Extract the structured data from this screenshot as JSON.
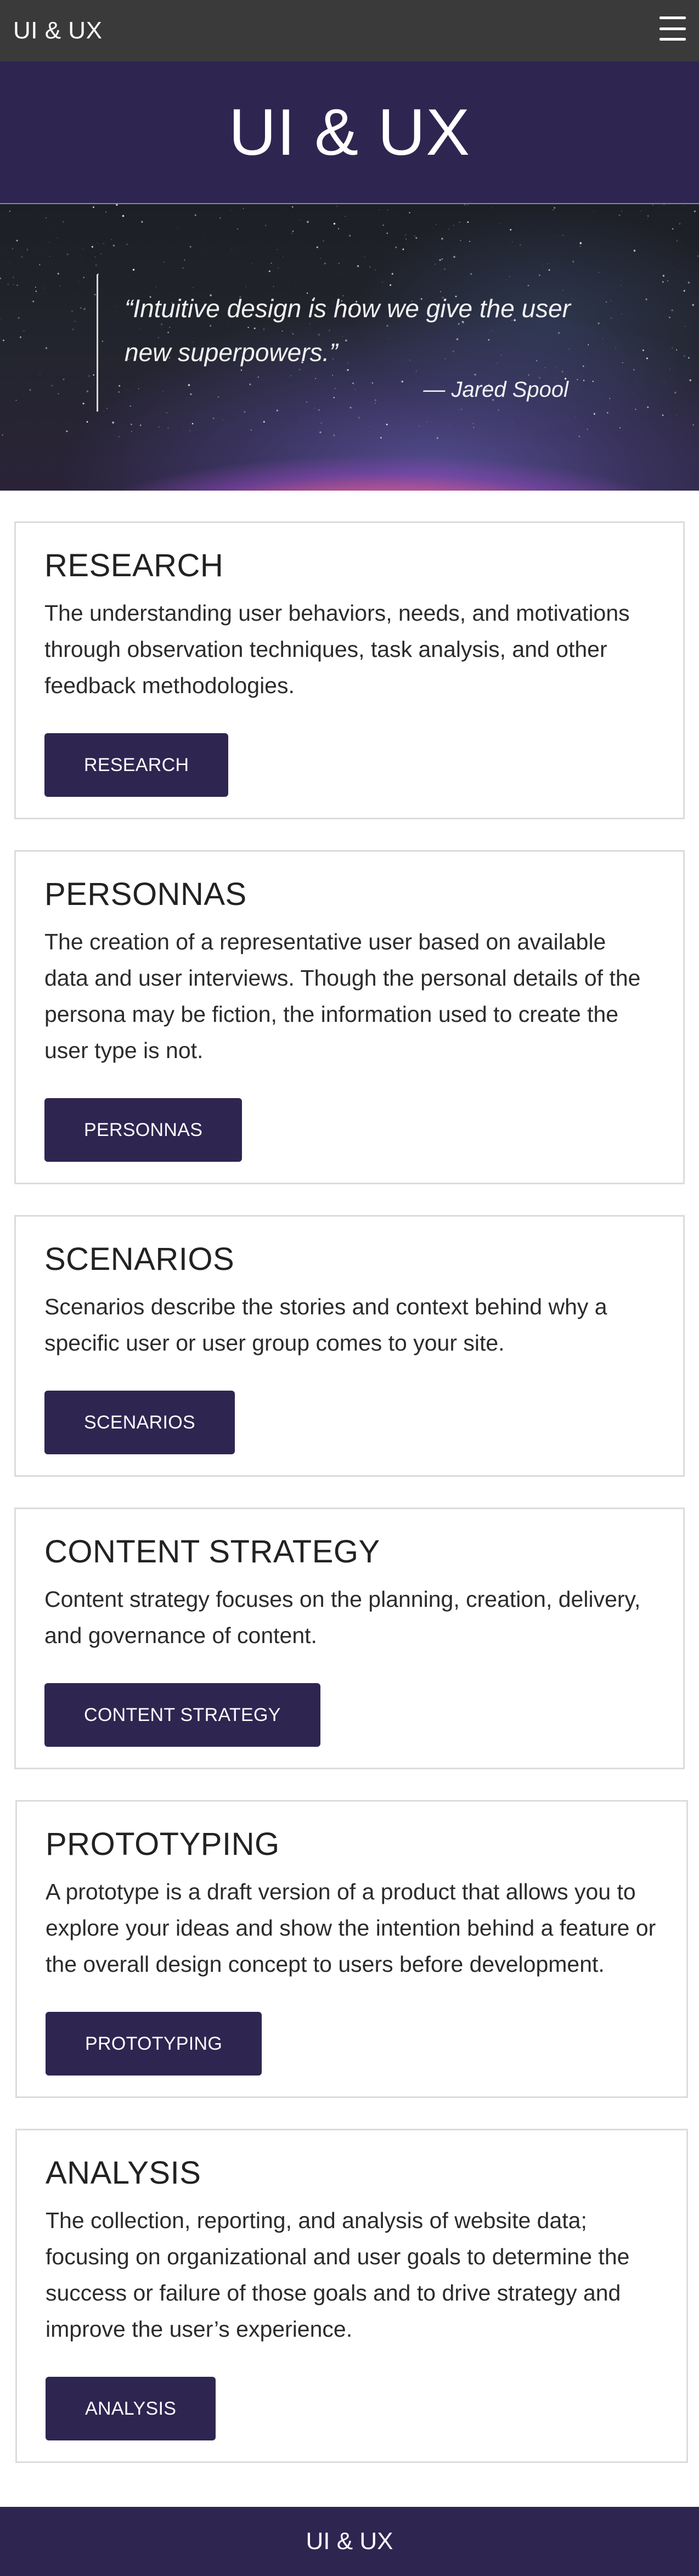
{
  "navbar": {
    "brand": "UI & UX",
    "menu_icon": "hamburger-menu-icon"
  },
  "header": {
    "title": "UI & UX"
  },
  "hero": {
    "quote": "“Intuitive design is how we give the user new superpowers.”",
    "author": "— Jared Spool"
  },
  "sections": [
    {
      "title": "RESEARCH",
      "body": "The understanding user behaviors, needs, and motivations through observation techniques, task analysis, and other feedback methodologies.",
      "button": "RESEARCH"
    },
    {
      "title": "PERSONNAS",
      "body": "The creation of a representative user based on available data and user interviews. Though the personal details of the persona may be fiction, the information used to create the user type is not.",
      "button": "PERSONNAS"
    },
    {
      "title": "SCENARIOS",
      "body": "Scenarios describe the stories and context behind why a specific user or user group comes to your site.",
      "button": "SCENARIOS"
    },
    {
      "title": "CONTENT STRATEGY",
      "body": "Content strategy focuses on the planning, creation, delivery, and governance of content.",
      "button": "CONTENT STRATEGY"
    },
    {
      "title": "PROTOTYPING",
      "body": "A prototype is a draft version of a product that allows you to explore your ideas and show the intention behind a feature or the overall design concept to users before development.",
      "button": "PROTOTYPING"
    },
    {
      "title": "ANALYSIS",
      "body": "The collection, reporting, and analysis of website data; focusing on organizational and user goals to determine the success or failure of those goals and to drive strategy and improve the user’s experience.",
      "button": "ANALYSIS"
    }
  ],
  "footer": {
    "text": "UI & UX"
  },
  "colors": {
    "navbar": "#3a3a3a",
    "brand_purple": "#2f2551",
    "card_border": "#dcdcdc"
  }
}
